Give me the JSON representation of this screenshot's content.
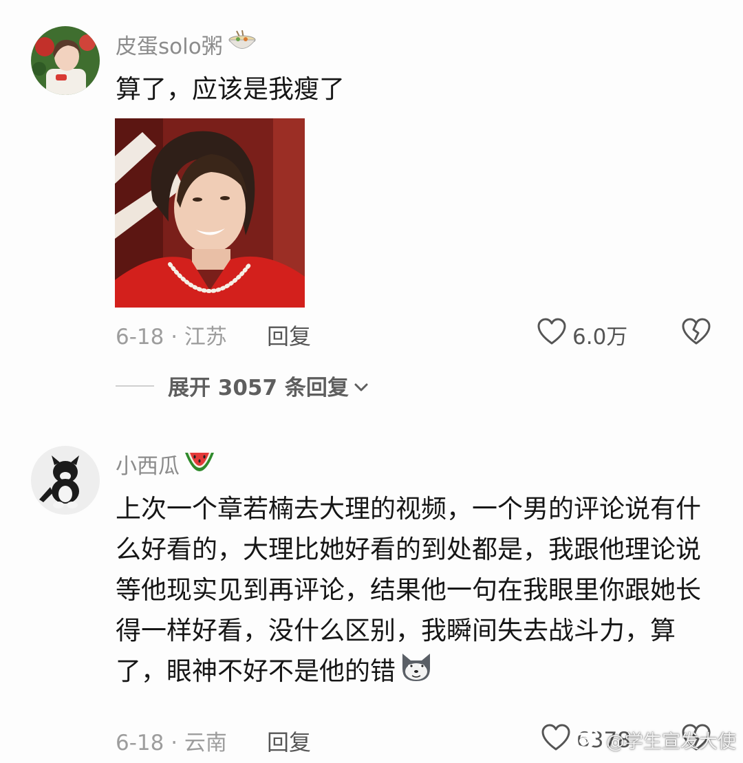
{
  "comments": [
    {
      "username": "皮蛋solo粥",
      "username_emoji": "noodle-bowl-icon",
      "text": "算了，应该是我瘦了",
      "has_image": true,
      "date_location": "6-18 · 江苏",
      "reply_label": "回复",
      "likes": "6.0万",
      "expand_replies": "展开 3057 条回复"
    },
    {
      "username": "小西瓜",
      "username_emoji": "watermelon-icon",
      "text": "上次一个章若楠去大理的视频，一个男的评论说有什么好看的，大理比她好看的到处都是，我跟他理论说等他现实见到再评论，结果他一句在我眼里你跟她长得一样好看，没什么区别，我瞬间失去战斗力，算了，眼神不好不是他的错",
      "text_emoji": "doge-icon",
      "date_location": "6-18 · 云南",
      "reply_label": "回复",
      "likes": "6378"
    }
  ],
  "watermark": {
    "text": "@学生宣发大使",
    "icon": "weibo-icon"
  },
  "colors": {
    "background": "#fdfdfd",
    "username": "#8c8c8c",
    "meta": "#9d9d9d",
    "text": "#161616"
  }
}
